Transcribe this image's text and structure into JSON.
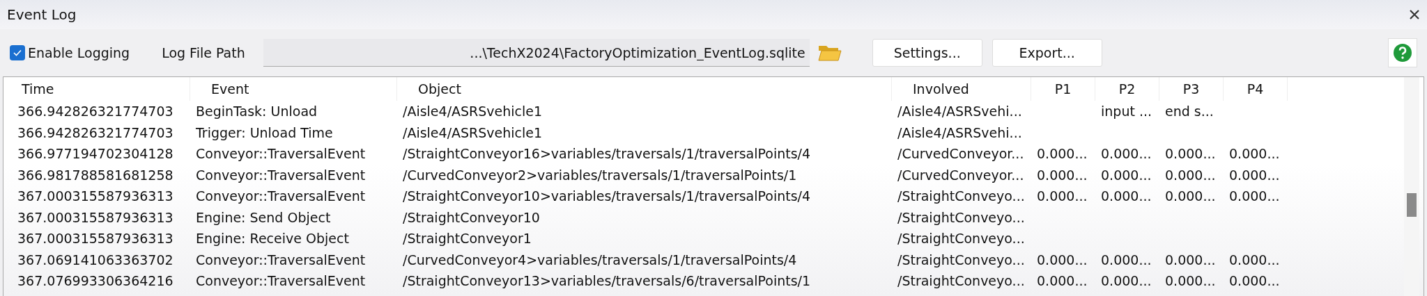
{
  "window": {
    "title": "Event Log"
  },
  "toolbar": {
    "enable_logging": {
      "label": "Enable Logging",
      "checked": true
    },
    "path_label": "Log File Path",
    "path_value": "...\\TechX2024\\FactoryOptimization_EventLog.sqlite",
    "buttons": [
      "Settings...",
      "Export..."
    ]
  },
  "table": {
    "columns": [
      "Time",
      "Event",
      "Object",
      "Involved",
      "P1",
      "P2",
      "P3",
      "P4"
    ],
    "rows": [
      [
        "366.942826321774703",
        "BeginTask: Unload",
        "/Aisle4/ASRSvehicle1",
        "/Aisle4/ASRSvehi...",
        "",
        "input ...",
        "end s...",
        ""
      ],
      [
        "366.942826321774703",
        "Trigger: Unload Time",
        "/Aisle4/ASRSvehicle1",
        "/Aisle4/ASRSvehi...",
        "",
        "",
        "",
        ""
      ],
      [
        "366.977194702304128",
        "Conveyor::TraversalEvent",
        "/StraightConveyor16>variables/traversals/1/traversalPoints/4",
        "/CurvedConveyor...",
        "0.000...",
        "0.000...",
        "0.000...",
        "0.000..."
      ],
      [
        "366.981788581681258",
        "Conveyor::TraversalEvent",
        "/CurvedConveyor2>variables/traversals/1/traversalPoints/1",
        "/CurvedConveyor...",
        "0.000...",
        "0.000...",
        "0.000...",
        "0.000..."
      ],
      [
        "367.000315587936313",
        "Conveyor::TraversalEvent",
        "/StraightConveyor10>variables/traversals/1/traversalPoints/4",
        "/StraightConveyo...",
        "0.000...",
        "0.000...",
        "0.000...",
        "0.000..."
      ],
      [
        "367.000315587936313",
        "Engine: Send Object",
        "/StraightConveyor10",
        "/StraightConveyo...",
        "",
        "",
        "",
        ""
      ],
      [
        "367.000315587936313",
        "Engine: Receive Object",
        "/StraightConveyor1",
        "/StraightConveyo...",
        "",
        "",
        "",
        ""
      ],
      [
        "367.069141063363702",
        "Conveyor::TraversalEvent",
        "/CurvedConveyor4>variables/traversals/1/traversalPoints/4",
        "/StraightConveyo...",
        "0.000...",
        "0.000...",
        "0.000...",
        "0.000..."
      ],
      [
        "367.076993306364216",
        "Conveyor::TraversalEvent",
        "/StraightConveyor13>variables/traversals/6/traversalPoints/1",
        "/StraightConveyo...",
        "0.000...",
        "0.000...",
        "0.000...",
        "0.000..."
      ]
    ]
  }
}
